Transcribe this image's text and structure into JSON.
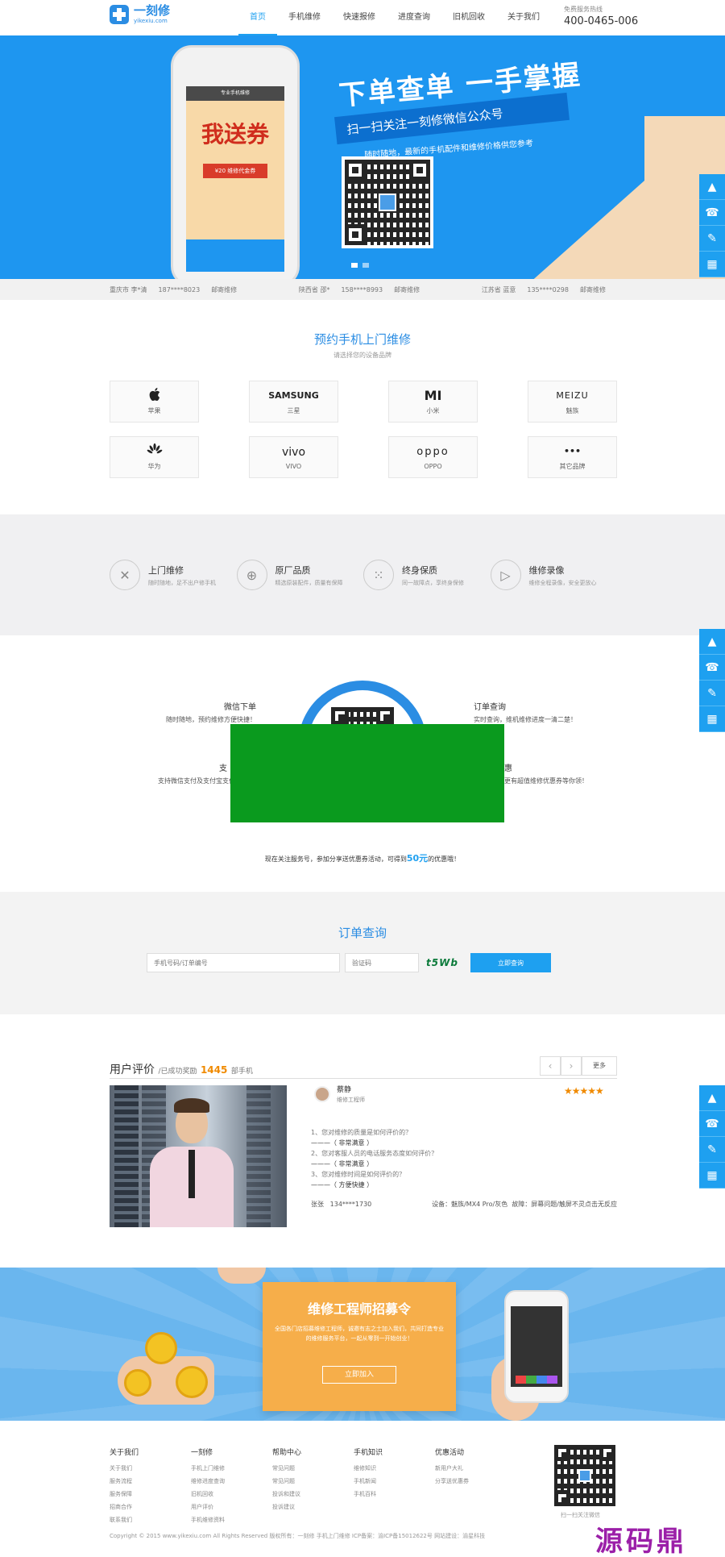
{
  "header": {
    "logo_name": "一刻修",
    "logo_sub": "yikexiu.com",
    "nav": [
      "首页",
      "手机维修",
      "快速报修",
      "进度查询",
      "旧机回收",
      "关于我们"
    ],
    "hotline_label": "免费服务热线",
    "hotline_number": "400-0465-006"
  },
  "banner": {
    "title": "下单查单 一手掌握",
    "subtitle": "扫一扫关注一刻修微信公众号",
    "note": "随时随地，最新的手机配件和维修价格供您参考",
    "phone_header": "专业手机维修",
    "phone_promo": "我送券",
    "phone_voucher": "¥20 维修代金券"
  },
  "ticker": [
    [
      "重庆市 李*清",
      "187****8023",
      "邮寄维修"
    ],
    [
      "陕西省 邵*",
      "158****8993",
      "邮寄维修"
    ],
    [
      "江苏省 蓝意",
      "135****0298",
      "邮寄维修"
    ]
  ],
  "brands": {
    "title": "预约手机上门维修",
    "subtitle": "请选择您的设备品牌",
    "items": [
      {
        "logo": "",
        "name": "苹果"
      },
      {
        "logo": "SAMSUNG",
        "name": "三星"
      },
      {
        "logo": "MI",
        "name": "小米"
      },
      {
        "logo": "MEIZU",
        "name": "魅族"
      },
      {
        "logo": "",
        "name": "华为"
      },
      {
        "logo": "vivo",
        "name": "VIVO"
      },
      {
        "logo": "oppo",
        "name": "OPPO"
      },
      {
        "logo": "•••",
        "name": "其它品牌"
      }
    ]
  },
  "features": [
    {
      "icon": "tools-icon",
      "title": "上门维修",
      "desc": "随时随地，足不出户修手机"
    },
    {
      "icon": "shield-plus-icon",
      "title": "原厂品质",
      "desc": "精选原装配件，质量有保障"
    },
    {
      "icon": "keypad-icon",
      "title": "终身保质",
      "desc": "同一故障点，享终身保修"
    },
    {
      "icon": "play-icon",
      "title": "维修录像",
      "desc": "维修全程录像，安全更放心"
    }
  ],
  "wechat": {
    "left_top_title": "微信下单",
    "left_top_desc": "随时随地，预约维修方便快捷！",
    "left_bottom_title": "支",
    "left_bottom_desc": "支持微信支付及支付宝支付，安全",
    "right_top_title": "订单查询",
    "right_top_desc": "实时查询，维机维修进度一清二楚！",
    "right_bottom_title": "惠",
    "right_bottom_desc": "更有超值维修优惠券等你领！",
    "bottom_prefix": "现在关注服务号，参加分享送优惠券活动，可得到",
    "bottom_amount": "50元",
    "bottom_suffix": "的优惠哦！"
  },
  "order": {
    "title": "订单查询",
    "phone_placeholder": "手机号码/订单编号",
    "code_placeholder": "验证码",
    "captcha": "t5Wb",
    "button": "立即查询"
  },
  "reviews": {
    "title": "用户评价",
    "count_prefix": "/已成功奖励",
    "count": "1445",
    "count_suffix": "部手机",
    "more": "更多",
    "prev": "‹",
    "next": "›",
    "user_name": "蔡静",
    "user_role": "维修工程师",
    "stars": "★★★★★",
    "qa": [
      {
        "q": "1、您对维修的质量是如何评价的？",
        "a": "———（ 非常满意 ）"
      },
      {
        "q": "2、您对客服人员的电话服务态度如何评价？",
        "a": "———（ 非常满意 ）"
      },
      {
        "q": "3、您对维修时间是如何评价的？",
        "a": "———（ 方便快捷 ）"
      }
    ],
    "phone_label": "张张",
    "phone": "134****1730",
    "device": "设备：魅族/MX4 Pro/灰色",
    "fault": "故障：屏幕问题/触屏不灵点击无反应"
  },
  "recruit": {
    "title": "维修工程师招募令",
    "desc": "全国各门店招募维修工程师，诚邀有志之士加入我们，共同打造专业的维修服务平台，一起从零到一开始创业！",
    "button": "立即加入"
  },
  "footer": {
    "columns": [
      {
        "title": "关于我们",
        "links": [
          "关于我们",
          "服务流程",
          "服务保障",
          "招商合作",
          "联系我们"
        ]
      },
      {
        "title": "一刻修",
        "links": [
          "手机上门维修",
          "维修进度查询",
          "旧机回收",
          "用户评价",
          "手机维修资料"
        ]
      },
      {
        "title": "帮助中心",
        "links": [
          "常见问题",
          "常见问题",
          "投诉和建议",
          "投诉建议"
        ]
      },
      {
        "title": "手机知识",
        "links": [
          "维修知识",
          "手机新闻",
          "手机百科"
        ]
      },
      {
        "title": "优惠活动",
        "links": [
          "新用户大礼",
          "分享送优惠券"
        ]
      }
    ],
    "copyright": "Copyright © 2015 www.yikexiu.com All Rights Reserved  版权所有：一刻修   手机上门维修   ICP备案：渝ICP备15012622号 网站建设：渝星科技",
    "qr_caption": "扫一扫关注微信"
  },
  "watermark": "源码鼎",
  "side": [
    "▲",
    "☎",
    "✎",
    "▦"
  ],
  "colors": {
    "brand": "#1ea0f0",
    "accent": "#f08a00",
    "green": "#0a9a1e"
  }
}
